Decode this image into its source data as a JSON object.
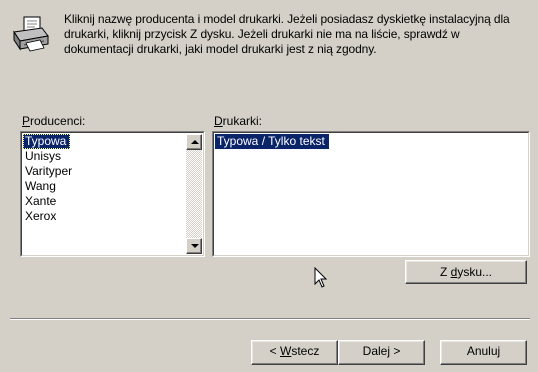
{
  "instructions": "Kliknij nazwę producenta i model drukarki. Jeżeli posiadasz dyskietkę instalacyjną dla drukarki, kliknij przycisk Z dysku. Jeżeli drukarki nie ma na liście, sprawdź w dokumentacji drukarki, jaki model drukarki jest z nią zgodny.",
  "producers": {
    "label_access": "P",
    "label_rest": "roducenci:",
    "items": [
      "Typowa",
      "Unisys",
      "Varityper",
      "Wang",
      "Xante",
      "Xerox"
    ],
    "selected": "Typowa"
  },
  "printers": {
    "label_access": "D",
    "label_rest": "rukarki:",
    "items": [
      "Typowa / Tylko tekst"
    ],
    "selected": "Typowa / Tylko tekst"
  },
  "buttons": {
    "from_disk_pre": "Z ",
    "from_disk_access": "d",
    "from_disk_post": "ysku...",
    "back_pre": "< ",
    "back_access": "W",
    "back_post": "stecz",
    "next": "Dalej >",
    "cancel": "Anuluj"
  },
  "icons": {
    "printer": "printer-icon",
    "cursor": "mouse-pointer-icon"
  },
  "colors": {
    "face": "#d4d0c8",
    "selection": "#0a246a"
  }
}
